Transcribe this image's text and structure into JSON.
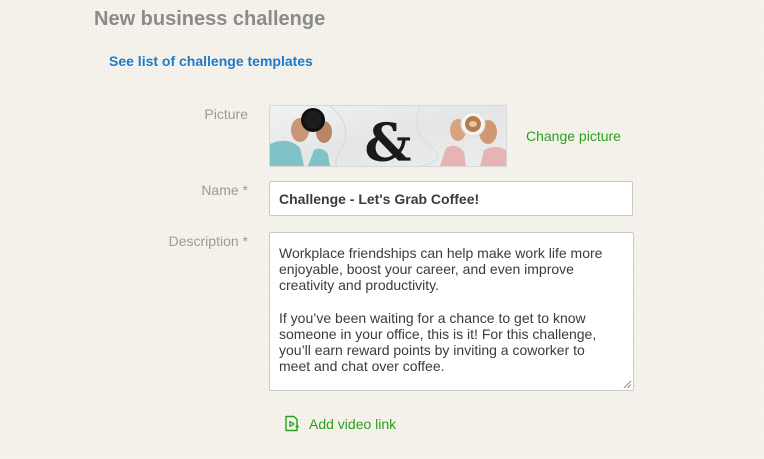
{
  "page": {
    "title": "New business challenge",
    "templates_link": "See list of challenge templates"
  },
  "form": {
    "picture": {
      "label": "Picture",
      "change_label": "Change picture",
      "image_icon": "coffee-challenge-picture"
    },
    "name": {
      "label": "Name *",
      "value": "Challenge - Let's Grab Coffee!"
    },
    "description": {
      "label": "Description *",
      "value": "Workplace friendships can help make work life more enjoyable, boost your career, and even improve creativity and productivity.\n\nIf you’ve been waiting for a chance to get to know someone in your office, this is it! For this challenge, you’ll earn reward points by inviting a coworker to meet and chat over coffee.\n\nAs you take your break, share details of your outing after"
    },
    "add_video": {
      "label": "Add video link",
      "icon": "video-link-icon"
    }
  },
  "colors": {
    "accent_green": "#2ca01c",
    "link_blue": "#1d7ac7",
    "title_gray": "#8b8b8b",
    "label_gray": "#9a9a9a"
  }
}
